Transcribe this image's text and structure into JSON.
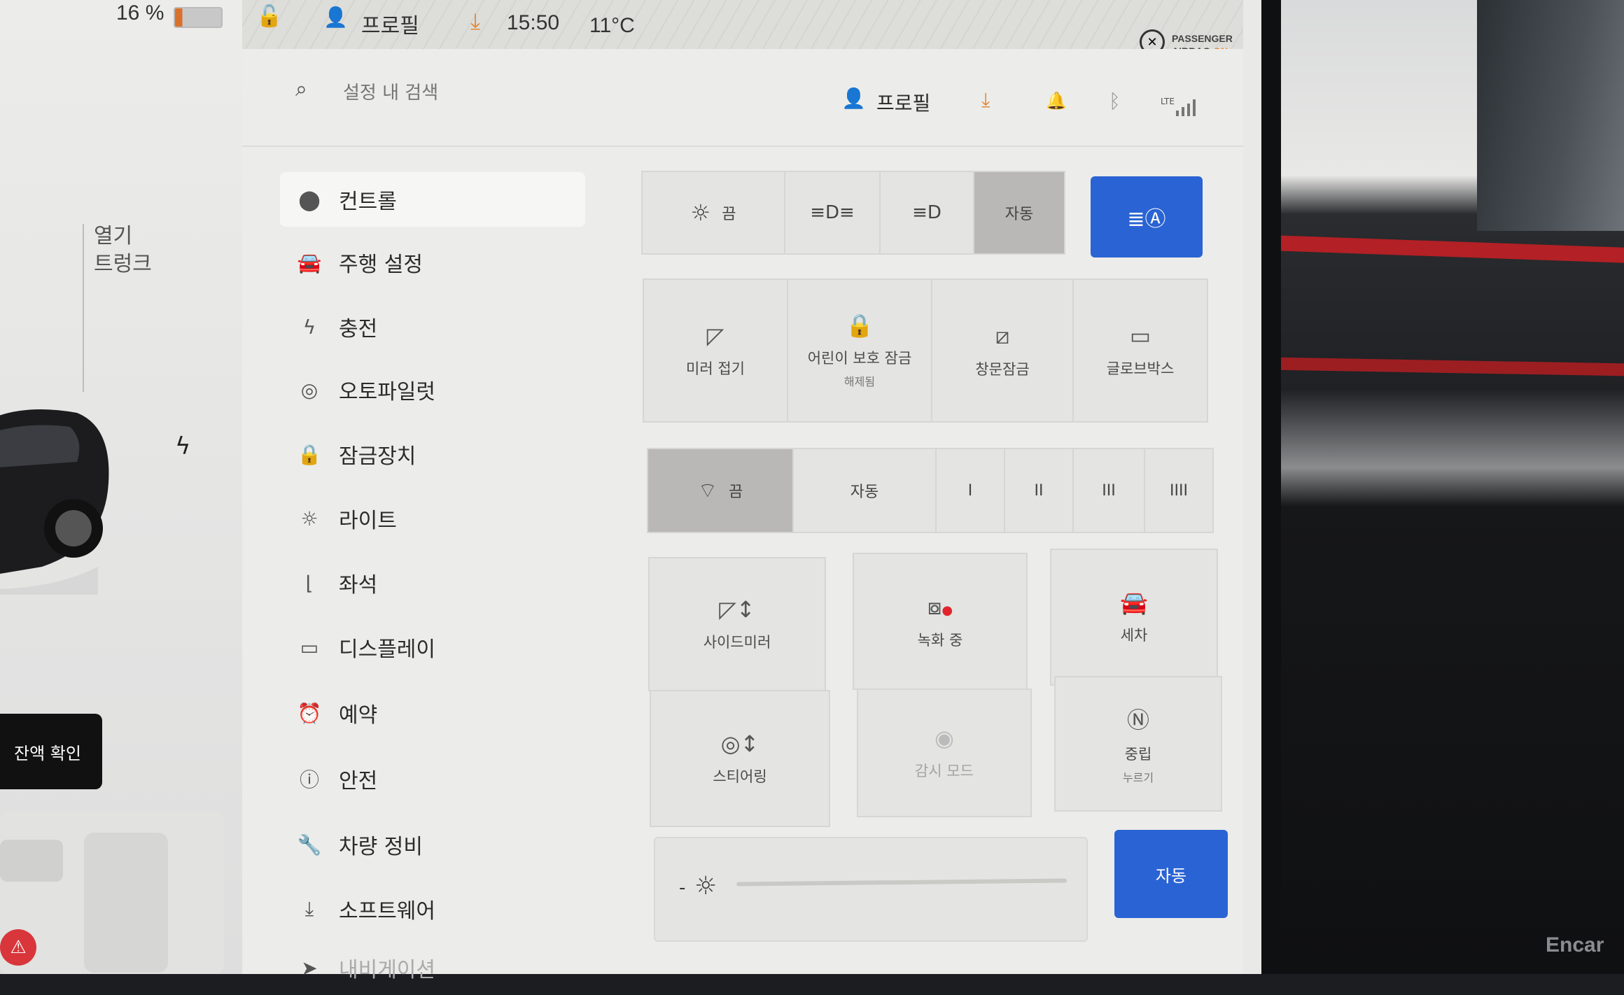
{
  "status_bar": {
    "battery_percent": "16 %",
    "battery_level": 0.16,
    "profile_label": "프로필",
    "time": "15:50",
    "temperature": "11°C",
    "airbag_line1": "PASSENGER",
    "airbag_line2": "AIRBAG",
    "airbag_state": "ON"
  },
  "left_panel": {
    "open_label": "열기",
    "trunk_label": "트렁크",
    "charge_check_button": "잔액 확인"
  },
  "search": {
    "placeholder": "설정 내 검색"
  },
  "header": {
    "profile_label": "프로필",
    "lte_label": "LTE"
  },
  "sidebar": {
    "items": [
      {
        "label": "컨트롤",
        "icon": "toggle-icon",
        "active": true
      },
      {
        "label": "주행 설정",
        "icon": "car-icon"
      },
      {
        "label": "충전",
        "icon": "lightning-icon"
      },
      {
        "label": "오토파일럿",
        "icon": "steering-wheel-icon"
      },
      {
        "label": "잠금장치",
        "icon": "lock-icon"
      },
      {
        "label": "라이트",
        "icon": "sun-icon"
      },
      {
        "label": "좌석",
        "icon": "seat-icon"
      },
      {
        "label": "디스플레이",
        "icon": "display-icon"
      },
      {
        "label": "예약",
        "icon": "alarm-clock-icon"
      },
      {
        "label": "안전",
        "icon": "alert-circle-icon"
      },
      {
        "label": "차량 정비",
        "icon": "wrench-icon"
      },
      {
        "label": "소프트웨어",
        "icon": "download-icon"
      },
      {
        "label": "내비게이션",
        "icon": "navigation-icon"
      }
    ]
  },
  "lights_row": {
    "off_label": "끔",
    "auto_label": "자동",
    "selected": "자동"
  },
  "controls_grid": {
    "mirror_fold": "미러 접기",
    "child_lock": "어린이 보호 잠금",
    "child_lock_sub": "해제됨",
    "window_lock": "창문잠금",
    "glovebox": "글로브박스"
  },
  "wipers": {
    "off_label": "끔",
    "auto_label": "자동",
    "speeds": [
      "I",
      "II",
      "III",
      "IIII"
    ],
    "selected": "끔"
  },
  "bottom_grid": {
    "side_mirror": "사이드미러",
    "recording": "녹화 중",
    "car_wash": "세차",
    "steering": "스티어링",
    "sentry_mode": "감시 모드",
    "neutral": "중립",
    "neutral_sub": "누르기"
  },
  "brightness": {
    "auto_label": "자동",
    "minus": "-"
  },
  "watermark": "Encar",
  "colors": {
    "accent_blue": "#2a63d3",
    "recording_dot": "#e0262c",
    "download_orange": "#e2883a"
  }
}
